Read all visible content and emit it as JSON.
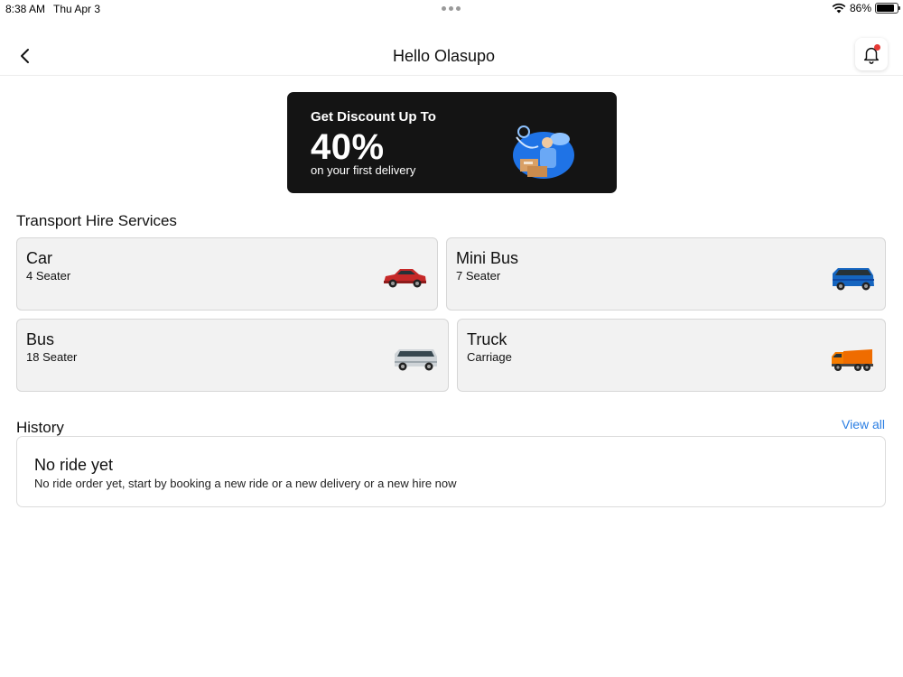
{
  "status_bar": {
    "time": "8:38 AM",
    "date": "Thu Apr 3",
    "battery": "86%",
    "battery_level": 0.86
  },
  "header": {
    "title": "Hello Olasupo",
    "back_icon": "chevron-left-icon",
    "notification_icon": "bell-icon",
    "notification_dot_color": "#e53935"
  },
  "promo": {
    "headline": "Get Discount Up To",
    "percent": "40%",
    "subtext": "on your first delivery",
    "background": "#141414",
    "illustration": "delivery-courier-illustration"
  },
  "services": {
    "title": "Transport Hire Services",
    "items": [
      {
        "name": "Car",
        "capacity": "4 Seater",
        "icon": "red-car-icon"
      },
      {
        "name": "Mini Bus",
        "capacity": "7 Seater",
        "icon": "blue-minibus-icon"
      },
      {
        "name": "Bus",
        "capacity": "18 Seater",
        "icon": "silver-van-icon"
      },
      {
        "name": "Truck",
        "capacity": "Carriage",
        "icon": "orange-truck-icon"
      }
    ]
  },
  "history": {
    "title": "History",
    "view_all": "View all",
    "empty_title": "No ride yet",
    "empty_desc": "No ride order yet, start by booking a new ride or a new delivery or a new hire now",
    "link_color": "#2a7ee3"
  }
}
